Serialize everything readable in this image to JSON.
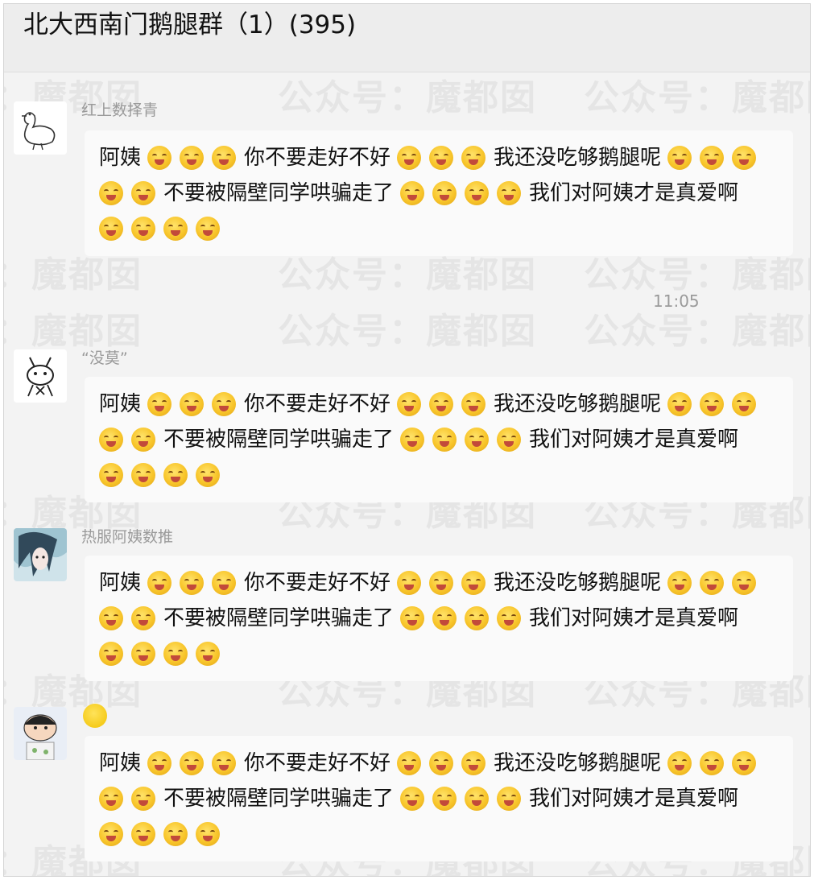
{
  "window": {
    "title": "北大西南门鹅腿群（1）(395)"
  },
  "chat": {
    "timestamp": "11:05",
    "message_text": {
      "line1_a": "阿姨",
      "line1_b": "你不要走好不好",
      "line1_c": "我还没吃够鹅腿呢",
      "line2_a": "不要被隔壁同学哄骗走了",
      "line2_b": "我们对阿姨才是真爱啊"
    },
    "messages": [
      {
        "sender": "红上数择青",
        "avatar": "goose-avatar"
      },
      {
        "sender": "“没莫”",
        "avatar": "character-sketch-avatar"
      },
      {
        "sender": "热服阿姨数推",
        "avatar": "anime-girl-avatar"
      },
      {
        "sender": "",
        "avatar": "cartoon-boy-avatar"
      }
    ]
  },
  "watermark": {
    "text": "公众号：魔都囡"
  },
  "icons": {
    "emoji": "yum-face-emoji"
  }
}
